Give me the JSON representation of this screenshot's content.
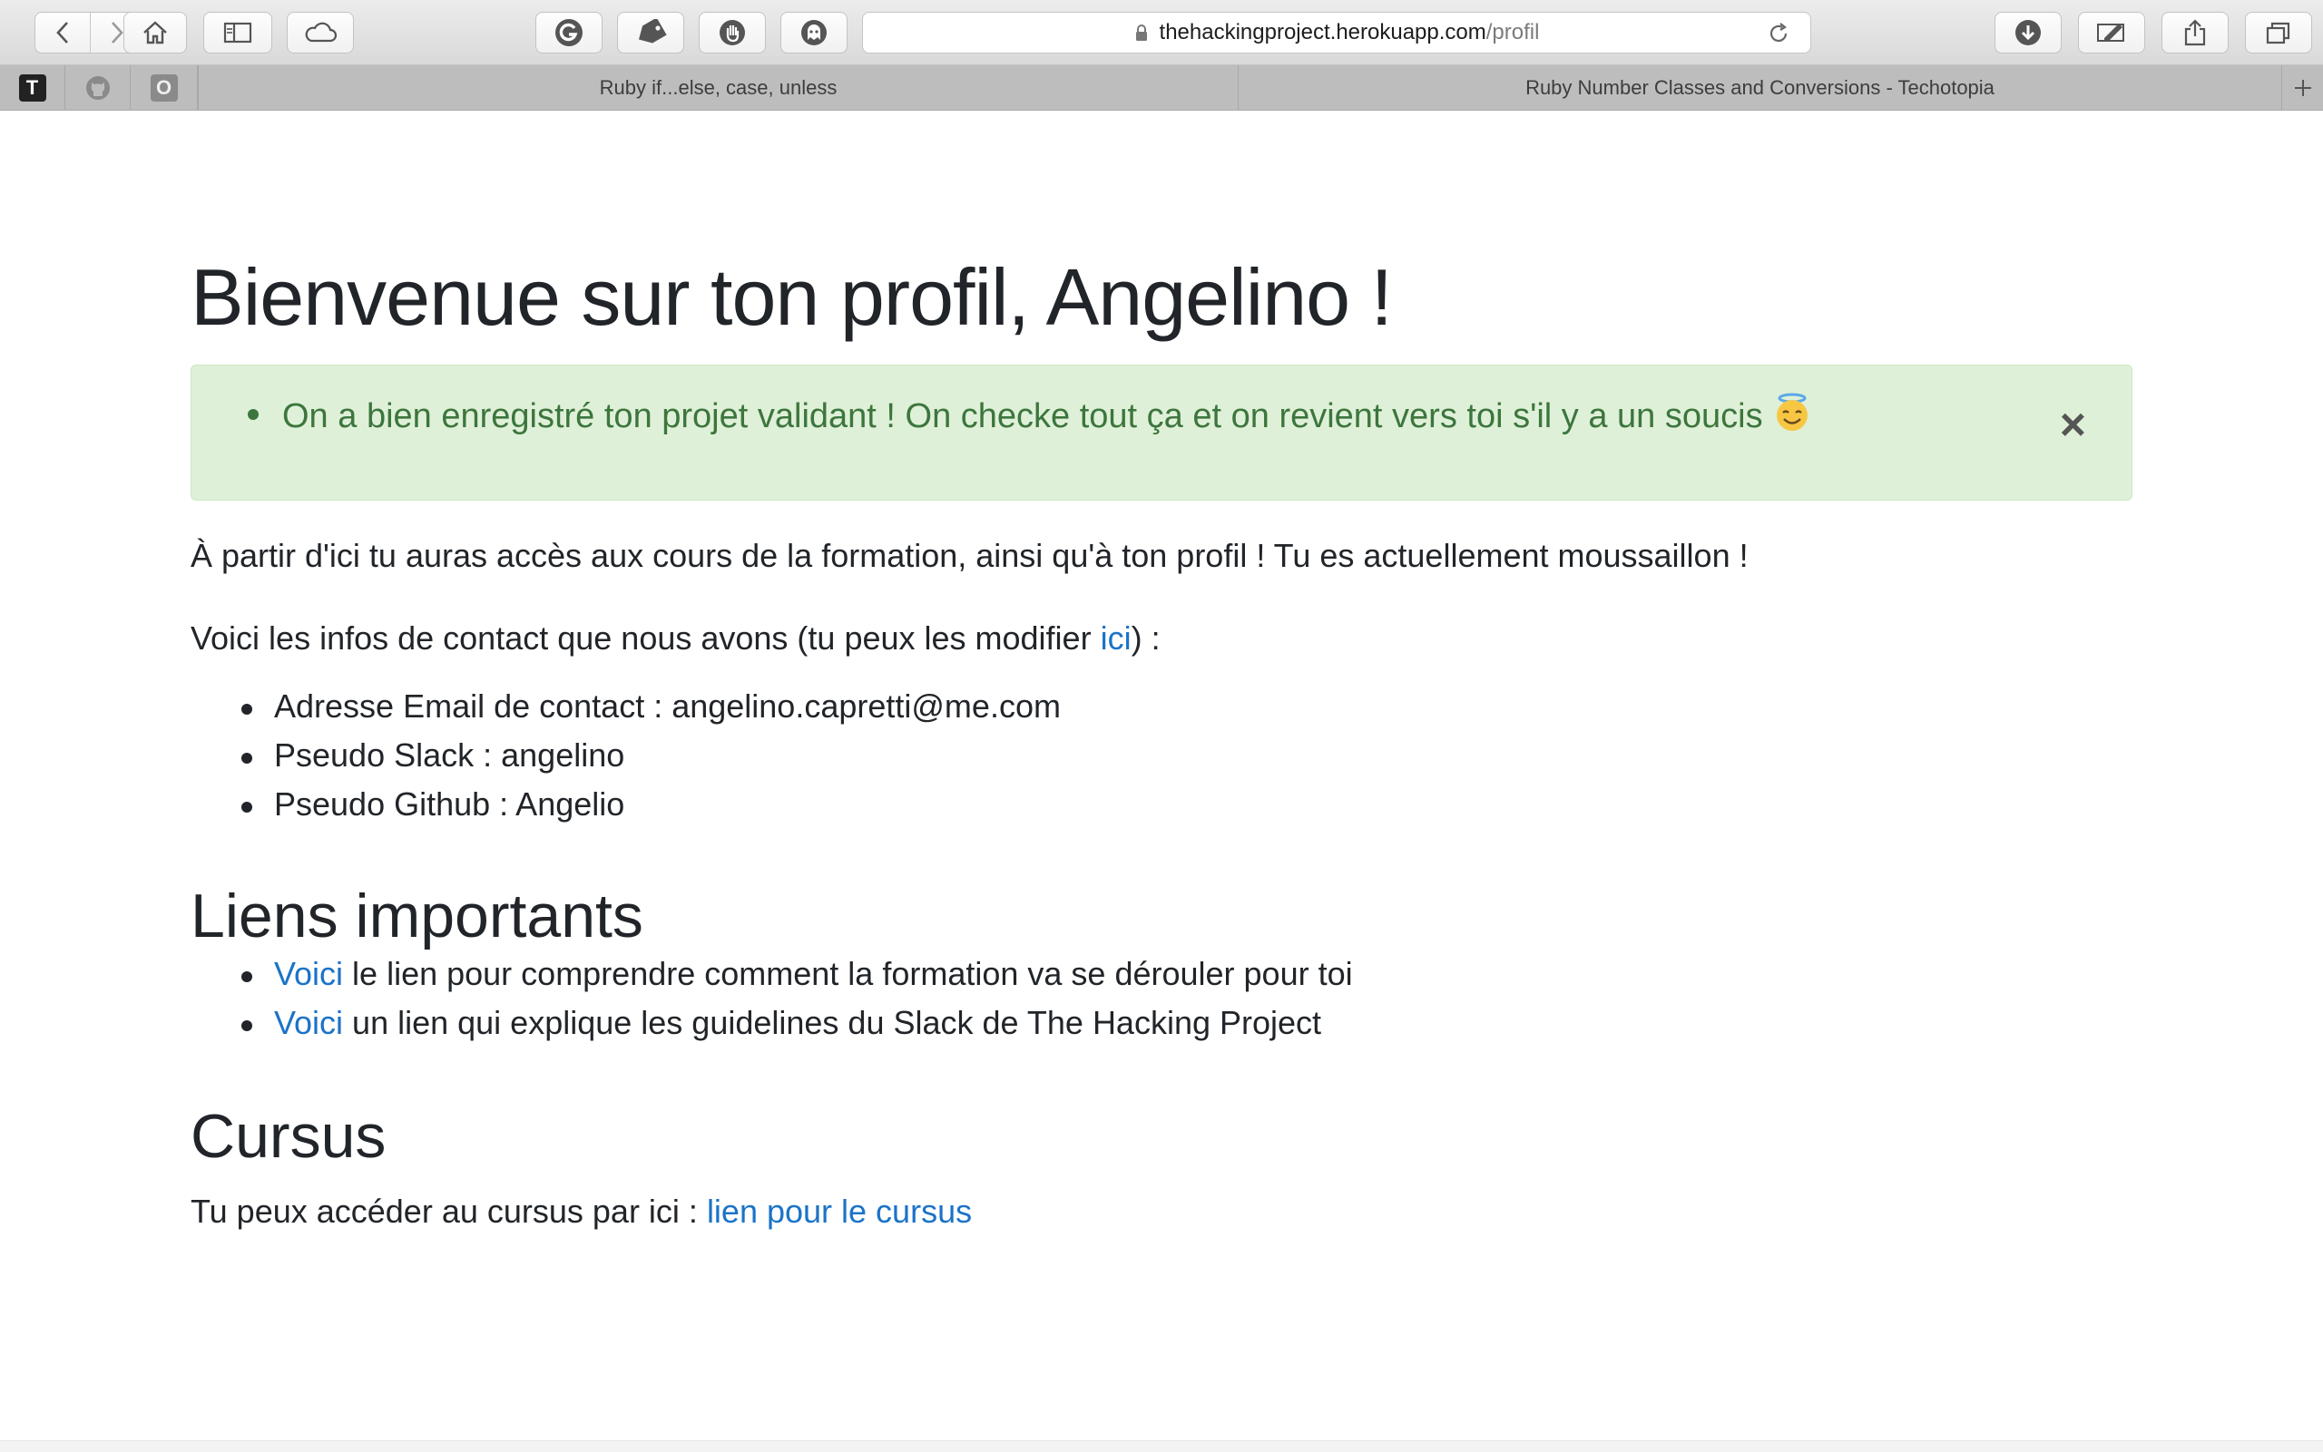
{
  "browser": {
    "url_host": "thehackingproject.herokuapp.com",
    "url_path": "/profil",
    "tabs": [
      {
        "label": "Ruby if...else, case, unless"
      },
      {
        "label": "Ruby Number Classes and Conversions - Techotopia"
      }
    ],
    "pinned_tabs": [
      {
        "icon": "t-letter-icon",
        "letter": "T"
      },
      {
        "icon": "github-icon"
      },
      {
        "icon": "o-letter-icon",
        "letter": "O"
      }
    ],
    "extension_icons": [
      "g-icon",
      "tag-icon",
      "hand-icon",
      "ghost-icon"
    ]
  },
  "page": {
    "title": "Bienvenue sur ton profil, Angelino !",
    "alert": {
      "message": "On a bien enregistré ton projet validant ! On checke tout ça et on revient vers toi s'il y a un soucis",
      "close": "×"
    },
    "intro": "À partir d'ici tu auras accès aux cours de la formation, ainsi qu'à ton profil ! Tu es actuellement moussaillon !",
    "contact_intro_before": "Voici les infos de contact que nous avons (tu peux les modifier ",
    "contact_link": "ici",
    "contact_intro_after": ") :",
    "contact_items": [
      "Adresse Email de contact : angelino.capretti@me.com",
      "Pseudo Slack : angelino",
      "Pseudo Github : Angelio"
    ],
    "links_heading": "Liens importants",
    "links": [
      {
        "link": "Voici",
        "text": " le lien pour comprendre comment la formation va se dérouler pour toi"
      },
      {
        "link": "Voici",
        "text": " un lien qui explique les guidelines du Slack de The Hacking Project"
      }
    ],
    "cursus_heading": "Cursus",
    "cursus_text": "Tu peux accéder au cursus par ici : ",
    "cursus_link": "lien pour le cursus"
  }
}
